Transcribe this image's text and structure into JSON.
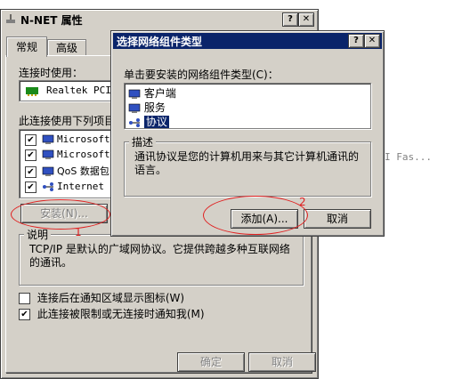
{
  "main_window": {
    "title": "N-NET 属性",
    "help_btn": "?",
    "close_btn": "✕",
    "tabs": [
      "常规",
      "高级"
    ],
    "connect_using_label": "连接时使用：",
    "adapter_name": "Realtek PCIe",
    "items_label": "此连接使用下列项目",
    "items": [
      {
        "label": "Microsoft",
        "checked": true
      },
      {
        "label": "Microsoft",
        "checked": true
      },
      {
        "label": "QoS 数据包",
        "checked": true
      },
      {
        "label": "Internet 协",
        "checked": true
      }
    ],
    "install_button": "安装(N)...",
    "description_group": "说明",
    "description_text": "TCP/IP 是默认的广域网协议。它提供跨越多种互联网络的通讯。",
    "show_icon_option": "连接后在通知区域显示图标(W)",
    "notify_option": "此连接被限制或无连接时通知我(M)",
    "ok_button": "确定",
    "cancel_button": "取消"
  },
  "background_fragment": "I Fas...",
  "dialog": {
    "title": "选择网络组件类型",
    "help_btn": "?",
    "close_btn": "✕",
    "prompt": "单击要安装的网络组件类型(C)：",
    "components": [
      "客户端",
      "服务",
      "协议"
    ],
    "selected_index": 2,
    "description_group": "描述",
    "description_text": "通讯协议是您的计算机用来与其它计算机通讯的语言。",
    "add_button": "添加(A)...",
    "cancel_button": "取消"
  },
  "annotations": {
    "marker_1": "1",
    "marker_2": "2",
    "color": "#e02020"
  }
}
